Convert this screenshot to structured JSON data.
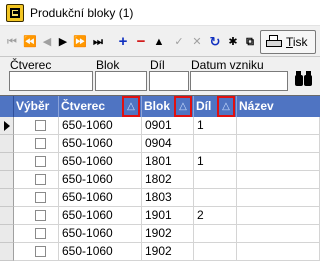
{
  "window": {
    "title": "Produkční bloky (1)"
  },
  "toolbar": {
    "buttons": [
      {
        "icon": "first-record-icon",
        "glyph": "⏮"
      },
      {
        "icon": "prev-page-icon",
        "glyph": "⏪"
      },
      {
        "icon": "prev-record-icon",
        "glyph": "◀"
      },
      {
        "icon": "next-record-icon",
        "glyph": "▶"
      },
      {
        "icon": "next-page-icon",
        "glyph": "⏩"
      },
      {
        "icon": "last-record-icon",
        "glyph": "⏭"
      },
      {
        "icon": "add-icon",
        "glyph": "+"
      },
      {
        "icon": "delete-icon",
        "glyph": "−"
      },
      {
        "icon": "move-up-icon",
        "glyph": "▲"
      },
      {
        "icon": "confirm-icon",
        "glyph": "✓"
      },
      {
        "icon": "cancel-icon",
        "glyph": "✕"
      },
      {
        "icon": "refresh-icon",
        "glyph": "↻"
      },
      {
        "icon": "asterisk-icon",
        "glyph": "✱"
      },
      {
        "icon": "copy-icon",
        "glyph": "⧉"
      }
    ],
    "print_label_underlined": "T",
    "print_label_rest": "isk"
  },
  "filters": {
    "ctverec_label": "Čtverec",
    "blok_label": "Blok",
    "dil_label": "Díl",
    "datum_label": "Datum vzniku",
    "ctverec_value": "",
    "blok_value": "",
    "dil_value": "",
    "datum_value": ""
  },
  "grid": {
    "columns": {
      "vyber": "Výběr",
      "ctverec": "Čtverec",
      "blok": "Blok",
      "dil": "Díl",
      "nazev": "Název"
    },
    "sort_indicator": "△",
    "rows": [
      {
        "ctverec": "650-1060",
        "blok": "0901",
        "dil": "1",
        "nazev": ""
      },
      {
        "ctverec": "650-1060",
        "blok": "0904",
        "dil": "",
        "nazev": ""
      },
      {
        "ctverec": "650-1060",
        "blok": "1801",
        "dil": "1",
        "nazev": ""
      },
      {
        "ctverec": "650-1060",
        "blok": "1802",
        "dil": "",
        "nazev": ""
      },
      {
        "ctverec": "650-1060",
        "blok": "1803",
        "dil": "",
        "nazev": ""
      },
      {
        "ctverec": "650-1060",
        "blok": "1901",
        "dil": "2",
        "nazev": ""
      },
      {
        "ctverec": "650-1060",
        "blok": "1902",
        "dil": "",
        "nazev": ""
      },
      {
        "ctverec": "650-1060",
        "blok": "1902",
        "dil": "",
        "nazev": ""
      }
    ],
    "current_row": 0
  },
  "colors": {
    "header": "#4f74c2",
    "sort_highlight": "#e01010"
  }
}
